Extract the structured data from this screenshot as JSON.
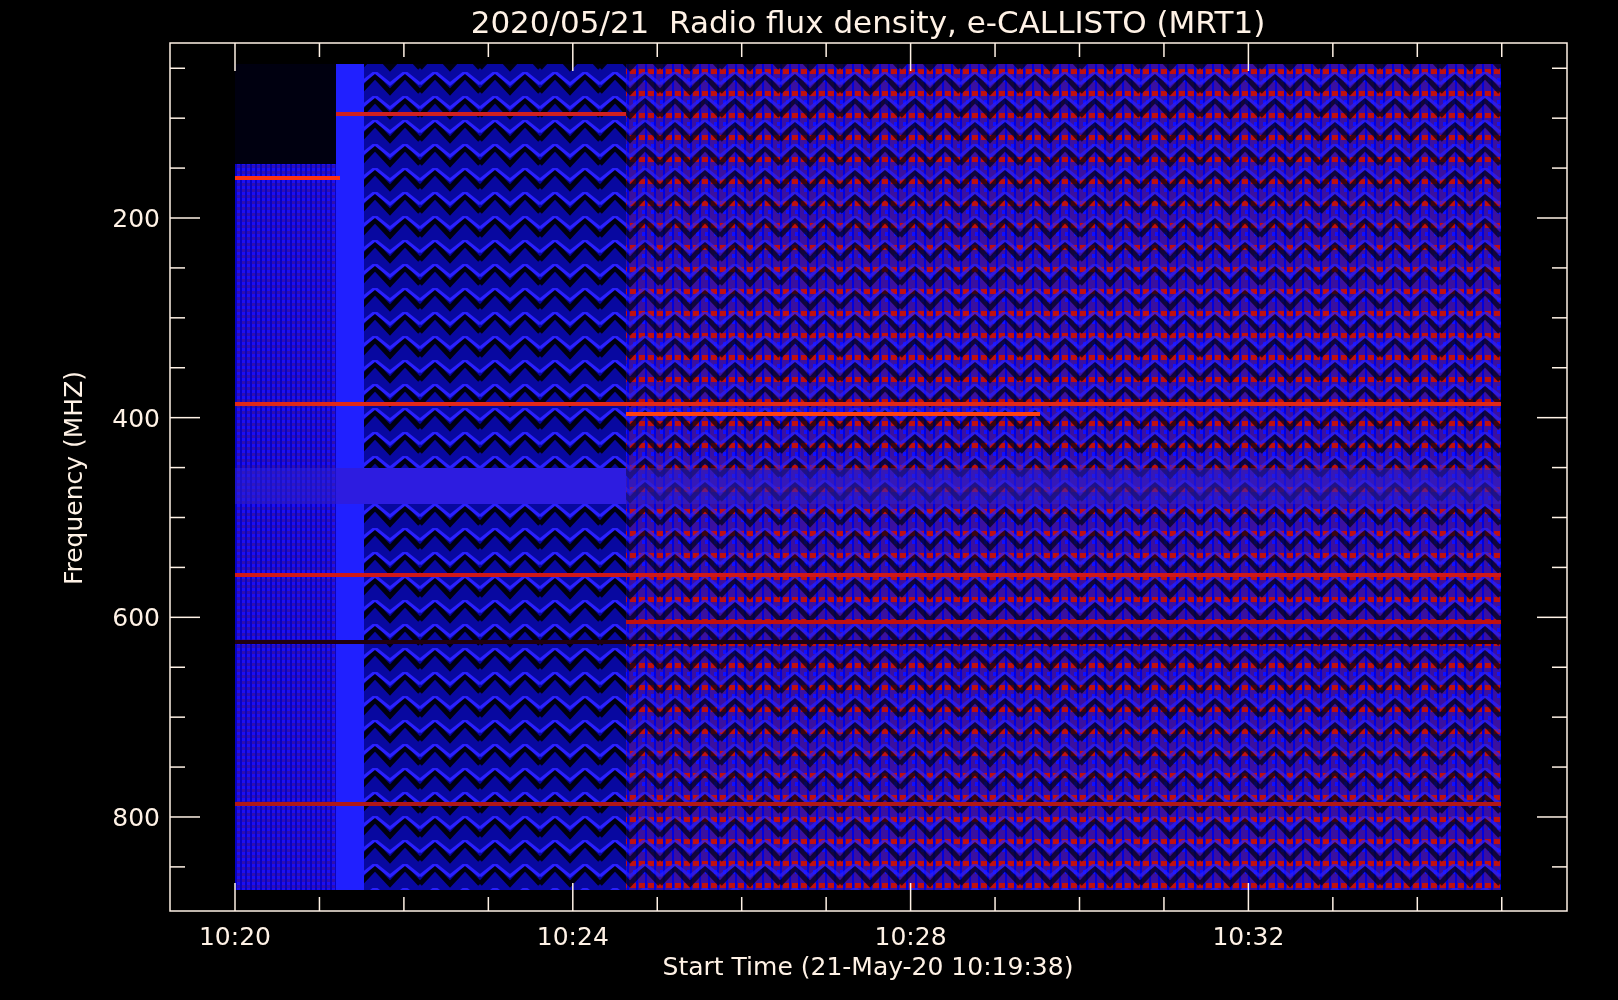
{
  "title": "2020/05/21  Radio flux density, e-CALLISTO (MRT1)",
  "y_axis": {
    "label": "Frequency (MHZ)",
    "ticks": [
      "200",
      "400",
      "600",
      "800"
    ]
  },
  "x_axis": {
    "label": "Start Time (21-May-20 10:19:38)",
    "ticks": [
      "10:20",
      "10:24",
      "10:28",
      "10:32"
    ]
  }
}
